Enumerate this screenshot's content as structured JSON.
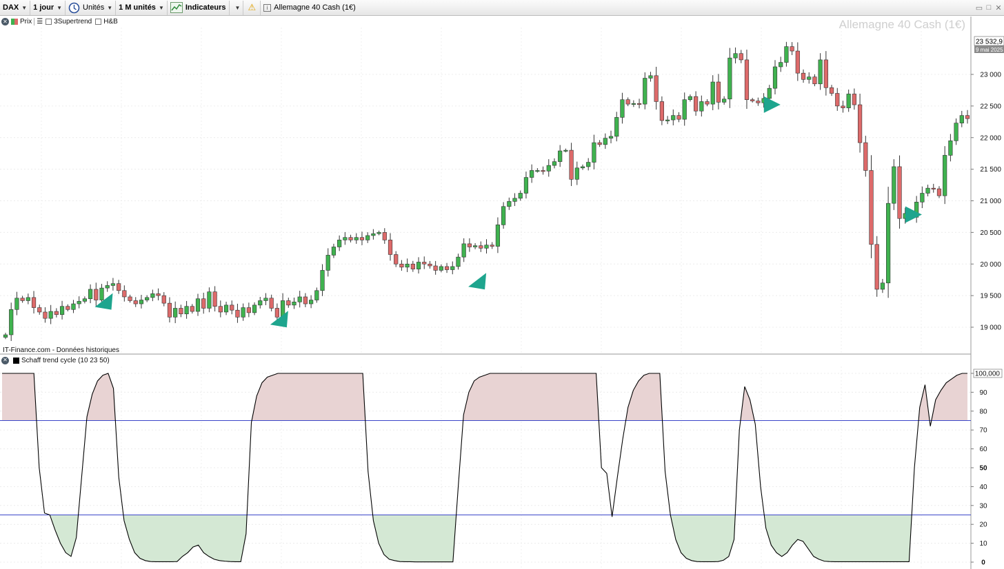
{
  "toolbar": {
    "symbol": "DAX",
    "period": "1 jour",
    "units_label": "Unités",
    "range": "1 M unités",
    "indicators": "Indicateurs",
    "instrument": "Allemagne 40 Cash (1€)"
  },
  "legend": {
    "price": "Prix",
    "supertrend": "3Supertrend",
    "hb": "H&B"
  },
  "watermark": "Allemagne 40 Cash (1€)",
  "credit": "IT-Finance.com - Données historiques",
  "last_price": {
    "value": "23 532,9",
    "date": "9 mai 2025"
  },
  "indicator_legend": "Schaff trend cycle (10 23 50)",
  "price_axis_labels": [
    "23 000",
    "22 500",
    "22 000",
    "21 500",
    "21 000",
    "20 500",
    "20 000",
    "19 500",
    "19 000"
  ],
  "stc_axis_labels": [
    "100,000",
    "90",
    "80",
    "70",
    "60",
    "50",
    "40",
    "30",
    "20",
    "10",
    "0"
  ],
  "colors": {
    "up": "#3fb24f",
    "down": "#dd6a6a",
    "signal": "#1ea58e",
    "band": "#3a45c9",
    "overbought_fill": "#e8d3d3",
    "oversold_fill": "#d4e8d4"
  },
  "chart_data": [
    {
      "type": "candlestick",
      "title": "Allemagne 40 Cash (1€)",
      "y_axis_ticks": [
        19000,
        19500,
        20000,
        20500,
        21000,
        21500,
        22000,
        22500,
        23000
      ],
      "ylim": [
        18850,
        23600
      ],
      "last": 23532.9,
      "closes": [
        18880,
        19280,
        19460,
        19420,
        19470,
        19310,
        19240,
        19140,
        19250,
        19200,
        19330,
        19280,
        19370,
        19410,
        19450,
        19600,
        19430,
        19620,
        19660,
        19690,
        19580,
        19480,
        19420,
        19370,
        19430,
        19470,
        19530,
        19500,
        19380,
        19160,
        19300,
        19210,
        19330,
        19250,
        19450,
        19300,
        19560,
        19330,
        19240,
        19350,
        19270,
        19160,
        19310,
        19230,
        19350,
        19420,
        19460,
        19300,
        19160,
        19420,
        19350,
        19400,
        19480,
        19370,
        19430,
        19580,
        19900,
        20140,
        20270,
        20380,
        20420,
        20380,
        20420,
        20380,
        20450,
        20480,
        20500,
        20380,
        20150,
        20000,
        19950,
        20000,
        19920,
        20030,
        20000,
        19970,
        19900,
        19960,
        19910,
        19960,
        20110,
        20320,
        20270,
        20290,
        20250,
        20300,
        20280,
        20620,
        20910,
        20990,
        21040,
        21120,
        21370,
        21480,
        21480,
        21470,
        21560,
        21620,
        21790,
        21800,
        21340,
        21520,
        21540,
        21610,
        21920,
        21890,
        21990,
        22020,
        22320,
        22600,
        22530,
        22540,
        22530,
        22940,
        22980,
        22570,
        22270,
        22280,
        22350,
        22290,
        22600,
        22650,
        22420,
        22570,
        22530,
        22880,
        22560,
        22610,
        23260,
        23330,
        23230,
        22600,
        22580,
        22550,
        22620,
        22780,
        23120,
        23190,
        23440,
        23370,
        23020,
        22920,
        22960,
        22850,
        23230,
        22790,
        22700,
        22500,
        22470,
        22690,
        22520,
        21920,
        21480,
        20310,
        19600,
        19700,
        20960,
        21540,
        20720,
        20800,
        20740,
        20980,
        21120,
        21200,
        21190,
        21080,
        21720,
        21950,
        22230,
        22350,
        22300
      ]
    },
    {
      "type": "line",
      "title": "Schaff trend cycle (10 23 50)",
      "y_axis_ticks": [
        0,
        10,
        20,
        30,
        40,
        50,
        60,
        70,
        80,
        90,
        100
      ],
      "ylim": [
        0,
        100
      ],
      "bands": [
        25,
        75
      ],
      "values": [
        100,
        100,
        100,
        100,
        100,
        100,
        100,
        50,
        26,
        25,
        17,
        10,
        5,
        3,
        13,
        45,
        77,
        89,
        96,
        99,
        100,
        92,
        45,
        22,
        12,
        5,
        2,
        0.8,
        0.3,
        0.2,
        0.2,
        0.2,
        0.2,
        0.3,
        3,
        5,
        8,
        9,
        5,
        3,
        1.5,
        0.8,
        0.5,
        0.3,
        0.2,
        0.2,
        15,
        74,
        88,
        95,
        98,
        99,
        100,
        100,
        100,
        100,
        100,
        100,
        100,
        100,
        100,
        100,
        100,
        100,
        100,
        100,
        100,
        100,
        100,
        48,
        22,
        10,
        4,
        1.5,
        0.8,
        0.3,
        0.2,
        0.2,
        0.1,
        0.1,
        0.1,
        0.1,
        0.1,
        0.1,
        0.1,
        0.1,
        40,
        78,
        90,
        96,
        98,
        99,
        100,
        100,
        100,
        100,
        100,
        100,
        100,
        100,
        100,
        100,
        100,
        100,
        100,
        100,
        100,
        100,
        100,
        100,
        100,
        100,
        100,
        50,
        47,
        24,
        45,
        65,
        82,
        91,
        96,
        99,
        100,
        100,
        100,
        48,
        25,
        12,
        5,
        2,
        0.8,
        0.3,
        0.2,
        0.2,
        0.2,
        0.3,
        1,
        3,
        12,
        70,
        93,
        86,
        73,
        40,
        18,
        9,
        5,
        3,
        5,
        9,
        12,
        11,
        7,
        3,
        1.5,
        0.5,
        0.3,
        0.2,
        0.2,
        0.2,
        0.2,
        0.2,
        0.2,
        0.2,
        0.2,
        0.2,
        0.2,
        0.2,
        0.2,
        0.2,
        0.2,
        0.2,
        50,
        82,
        94,
        72,
        86,
        91,
        95,
        97,
        99,
        100,
        100
      ]
    }
  ],
  "signals": [
    {
      "bar": 17,
      "price": 19560,
      "direction": "up"
    },
    {
      "bar": 48,
      "price": 19280,
      "direction": "up"
    },
    {
      "bar": 83,
      "price": 19880,
      "direction": "up"
    },
    {
      "bar": 135,
      "price": 22500,
      "direction": "down"
    },
    {
      "bar": 160,
      "price": 20760,
      "direction": "down"
    }
  ]
}
